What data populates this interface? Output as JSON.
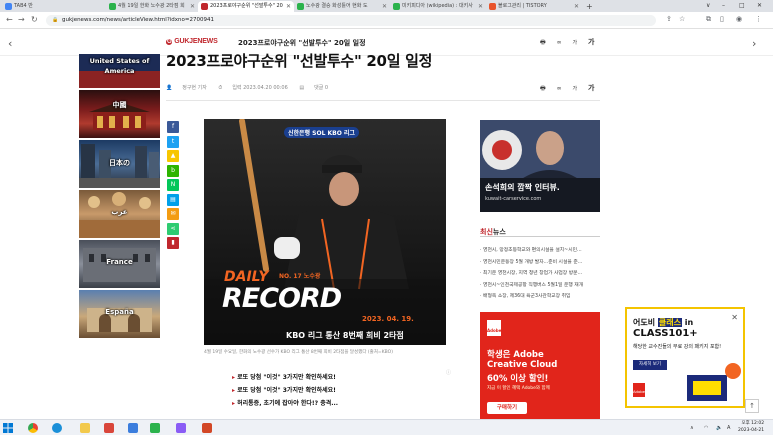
{
  "browser": {
    "tabs": [
      {
        "label": "TAB4 반",
        "color": "#4285f4"
      },
      {
        "label": "4월 19일 한화 노수광 2타점 희",
        "color": "#2bb24c"
      },
      {
        "label": "2023프로야구순위 \"선발투수\" 20",
        "color": "#c0272d",
        "active": true
      },
      {
        "label": "노수광 결승 화성틀어 현화 도",
        "color": "#2bb24c"
      },
      {
        "label": "미키피디아 (wikipedia) : 대키사",
        "color": "#2bb24c"
      },
      {
        "label": "블로그관리 | TISTORY",
        "color": "#e8542c"
      }
    ],
    "new_tab": "+",
    "url": "gukjenews.com/news/articleView.html?idxno=2700941",
    "window_controls": [
      "∨",
      "–",
      "□",
      "✕"
    ]
  },
  "header": {
    "logo": "GUKJENEWS",
    "title": "2023프로야구순위 \"선발투수\" 20일 일정",
    "tools": [
      "🖶",
      "∞",
      "가",
      "가"
    ]
  },
  "article": {
    "title": "2023프로야구순위 \"선발투수\" 20일 일정",
    "author": "정구현 기자",
    "date": "입력 2023.04.20 00:06",
    "comments": "댓글 0",
    "tools": [
      "🖶",
      "∞",
      "가",
      "가"
    ],
    "photo": {
      "sponsor": "신한은행 SOL KBO 리그",
      "daily": "DAILY",
      "record": "RECORD",
      "player": "NO. 17 노수광",
      "date": "2023. 04. 19.",
      "subtitle": "KBO 리그 통산 8번째 희비 2타점"
    },
    "caption": "4월 19일 수요일, 한화의 노수광 선수가 KBO 리그 통산 8번째 희비 2타점을 달성했다 (출처=KBO)",
    "links": [
      "로또 당첨 \"이것\" 3가지만 확인하세요!",
      "로또 당첨 \"이것\" 3가지만 확인하세요!",
      "허리통증, 초기에 잡아야 한다!? 충격..."
    ],
    "more_icon": "ⓘ"
  },
  "lang_banners": [
    "United States of America",
    "中國",
    "日本の",
    "عرب",
    "France",
    "España"
  ],
  "share": [
    {
      "icon": "f",
      "color": "#3b5998"
    },
    {
      "icon": "t",
      "color": "#1da1f2"
    },
    {
      "icon": "▲",
      "color": "#f7c600"
    },
    {
      "icon": "b",
      "color": "#2db400"
    },
    {
      "icon": "N",
      "color": "#03c75a"
    },
    {
      "icon": "▤",
      "color": "#00a0e9"
    },
    {
      "icon": "✉",
      "color": "#f39c12"
    },
    {
      "icon": "⋖",
      "color": "#2ecc71"
    },
    {
      "icon": "▮",
      "color": "#c0272d"
    }
  ],
  "ads": {
    "ad1_text": "손석희의 깜짝 인터뷰.",
    "ad1_url": "kuwait-carservice.com",
    "ad2": {
      "logo": "Adobe",
      "line1": "학생은 Adobe",
      "line2": "Creative Cloud",
      "line3": "60% 이상 할인!",
      "line4": "지금 이 할인 혜택 Adobe와 함께",
      "button": "구매하기"
    },
    "ad3": {
      "line1a": "어도비",
      "line1b": "클래스",
      "line1c": "in",
      "line2": "CLASS101+",
      "line3": "해당한 교수진들의 무료 강의 패키지 포함!",
      "button": "자세히 보기",
      "logo": "Adobe",
      "close": "✕"
    }
  },
  "news": {
    "head_red": "최신",
    "head_rest": "뉴스",
    "items": [
      "· 영천시, 망정초등학교와 편의시설을 설치~시민...",
      "· 영천시민운동장 5월 개방 발자...준비 시설을 준...",
      "· 최기운 영천시장, 지역 청년 창업가 사업장 방문...",
      "· 영천시~인천국제공항 직행버스 5월1일 운행 재개",
      "· 배형옥 소장, 제36대 육군3사관학교장 취임"
    ]
  },
  "taskbar": {
    "time": "오후 12:02",
    "date": "2023-04-21"
  }
}
